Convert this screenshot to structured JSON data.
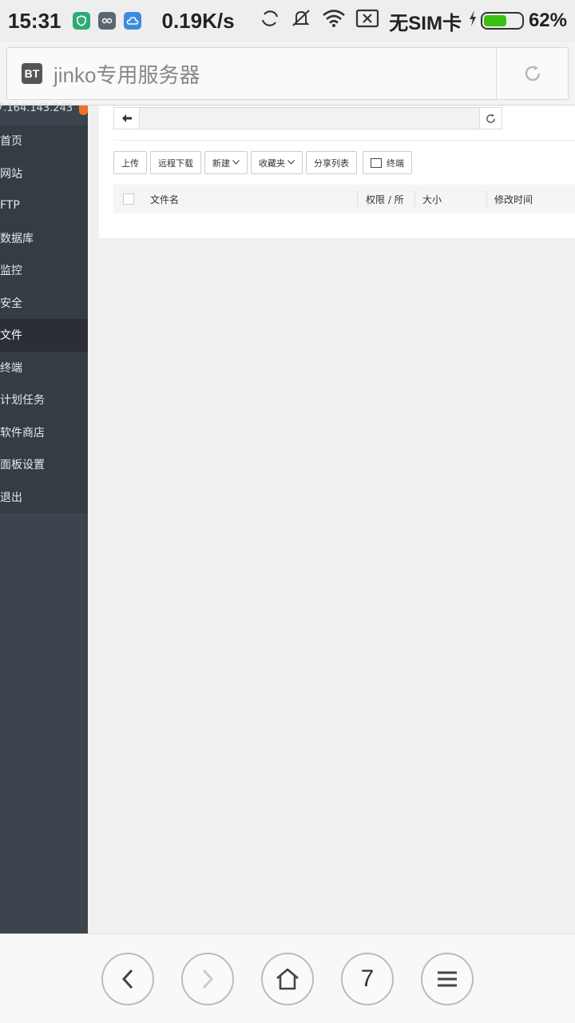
{
  "status": {
    "time": "15:31",
    "speed": "0.19K/s",
    "sim": "无SIM卡",
    "battery": "62%",
    "battery_level": 0.62
  },
  "browser": {
    "logo": "BT",
    "title": "jinko专用服务器",
    "tab_count": "7"
  },
  "sidebar": {
    "ip": "7.164.143.243",
    "badge": "0",
    "items": [
      {
        "label": "首页",
        "id": "home"
      },
      {
        "label": "网站",
        "id": "site"
      },
      {
        "label": "FTP",
        "id": "ftp"
      },
      {
        "label": "数据库",
        "id": "database"
      },
      {
        "label": "监控",
        "id": "monitor"
      },
      {
        "label": "安全",
        "id": "security"
      },
      {
        "label": "文件",
        "id": "files",
        "active": true
      },
      {
        "label": "终端",
        "id": "terminal"
      },
      {
        "label": "计划任务",
        "id": "cron"
      },
      {
        "label": "软件商店",
        "id": "store"
      },
      {
        "label": "面板设置",
        "id": "settings"
      },
      {
        "label": "退出",
        "id": "logout"
      }
    ]
  },
  "files": {
    "path_value": "",
    "toolbar": {
      "upload": "上传",
      "remote_download": "远程下载",
      "new": "新建",
      "favorites": "收藏夹",
      "share_list": "分享列表",
      "terminal": "终端"
    },
    "columns": {
      "name": "文件名",
      "permission": "权限 / 所",
      "size": "大小",
      "mtime": "修改时间"
    }
  }
}
